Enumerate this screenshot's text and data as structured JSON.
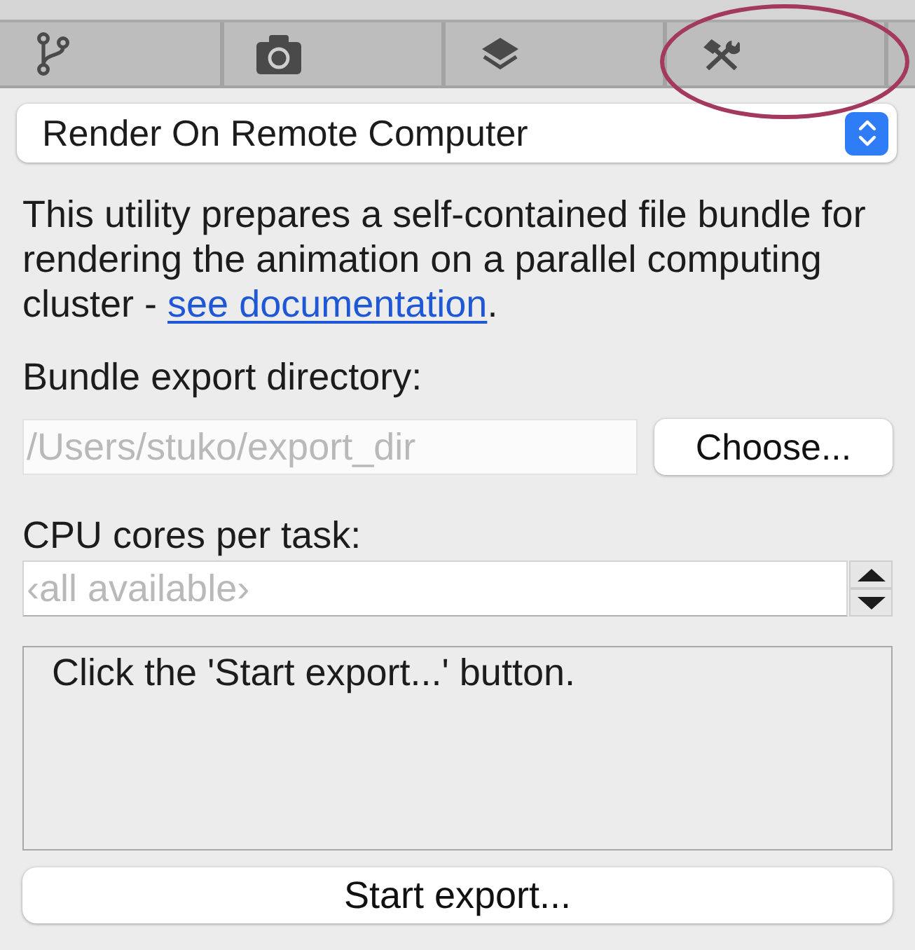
{
  "tabs": [
    {
      "highlighted": false
    },
    {
      "highlighted": false
    },
    {
      "highlighted": false
    },
    {
      "highlighted": true
    }
  ],
  "mode_select": {
    "value": "Render On Remote Computer"
  },
  "description": {
    "text": "This utility prepares a self-contained file bundle for rendering the animation on a parallel computing cluster - ",
    "link": "see documentation",
    "end": "."
  },
  "export_directory": {
    "label": "Bundle export directory:",
    "placeholder": "/Users/stuko/export_dir",
    "button": "Choose..."
  },
  "cpu_cores": {
    "label": "CPU cores per task:",
    "placeholder": "‹all available›"
  },
  "log": {
    "text": "Click the 'Start export...' button."
  },
  "start_button": {
    "label": "Start export..."
  }
}
